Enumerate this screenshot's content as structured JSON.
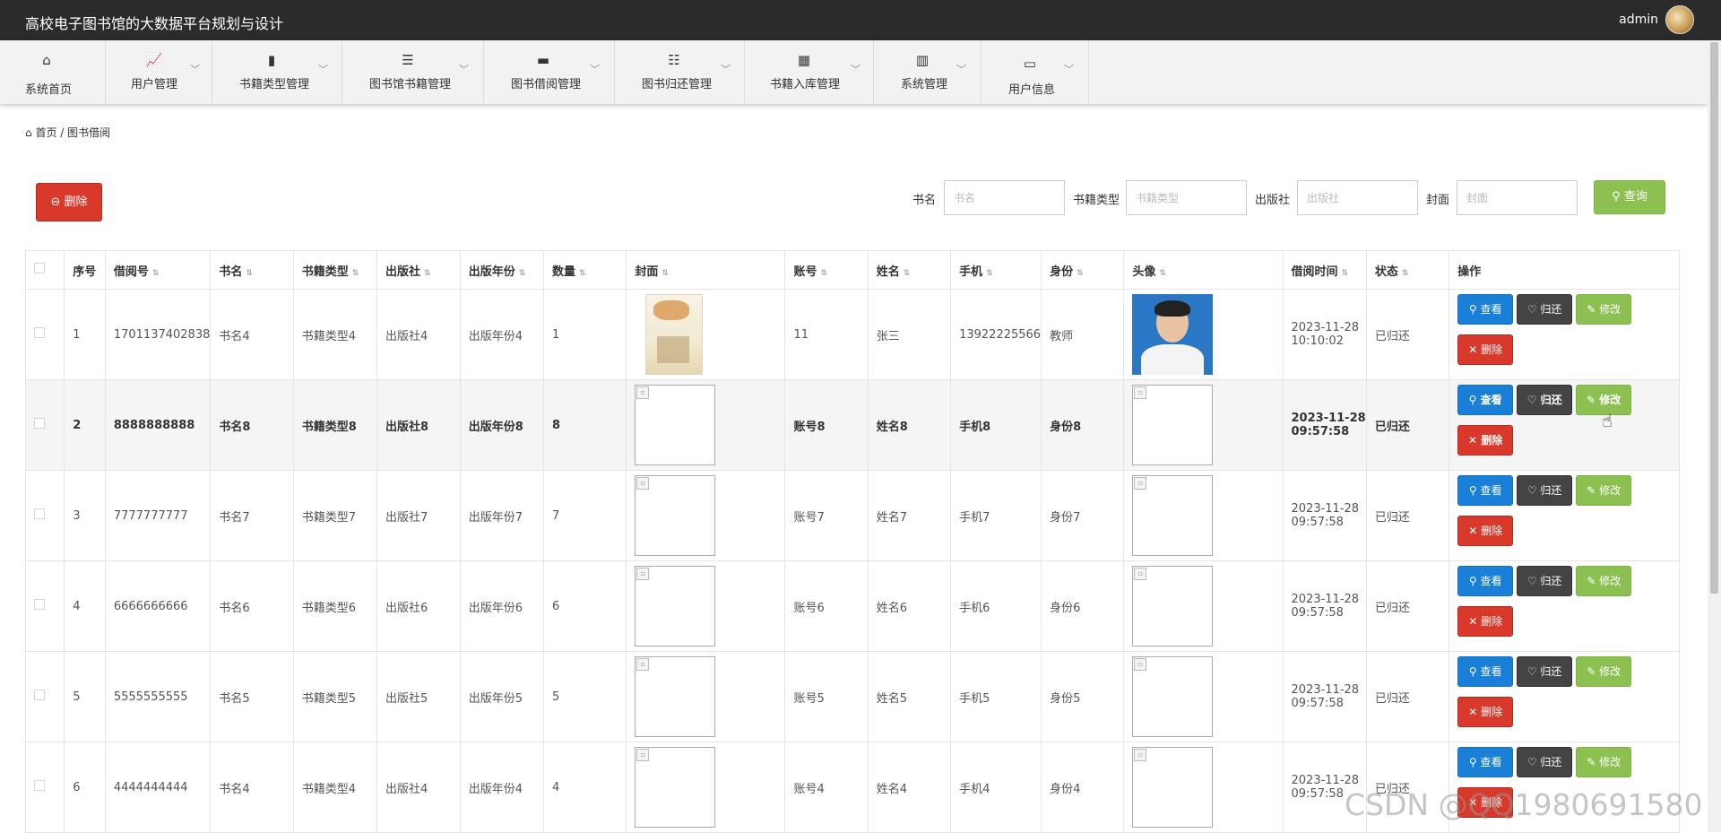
{
  "app": {
    "title": "高校电子图书馆的大数据平台规划与设计",
    "user": "admin"
  },
  "nav": [
    {
      "label": "系统首页",
      "icon": "home-icon"
    },
    {
      "label": "用户管理",
      "icon": "chart-line-icon"
    },
    {
      "label": "书籍类型管理",
      "icon": "ticket-icon"
    },
    {
      "label": "图书馆书籍管理",
      "icon": "list-icon"
    },
    {
      "label": "图书借阅管理",
      "icon": "comment-icon"
    },
    {
      "label": "图书归还管理",
      "icon": "sliders-icon"
    },
    {
      "label": "书籍入库管理",
      "icon": "grid-icon"
    },
    {
      "label": "系统管理",
      "icon": "bar-chart-icon"
    },
    {
      "label": "用户信息",
      "icon": "wallet-icon"
    }
  ],
  "breadcrumb": {
    "home": "首页",
    "sep": "/",
    "current": "图书借阅"
  },
  "toolbar": {
    "delete_label": "删除",
    "query_label": "查询"
  },
  "filters": [
    {
      "label": "书名",
      "placeholder": "书名"
    },
    {
      "label": "书籍类型",
      "placeholder": "书籍类型"
    },
    {
      "label": "出版社",
      "placeholder": "出版社"
    },
    {
      "label": "封面",
      "placeholder": "封面"
    }
  ],
  "table": {
    "headers": [
      "序号",
      "借阅号",
      "书名",
      "书籍类型",
      "出版社",
      "出版年份",
      "数量",
      "封面",
      "账号",
      "姓名",
      "手机",
      "身份",
      "头像",
      "借阅时间",
      "状态",
      "操作"
    ],
    "ops": {
      "view": "查看",
      "return": "归还",
      "edit": "修改",
      "delete": "删除"
    },
    "rows": [
      {
        "no": "1",
        "borrow_no": "1701137402838",
        "book": "书名4",
        "type": "书籍类型4",
        "publisher": "出版社4",
        "year": "出版年份4",
        "qty": "1",
        "account": "11",
        "name": "张三",
        "phone": "13922225566",
        "role": "教师",
        "time_date": "2023-11-28",
        "time_clock": "10:10:02",
        "status": "已归还"
      },
      {
        "no": "2",
        "borrow_no": "8888888888",
        "book": "书名8",
        "type": "书籍类型8",
        "publisher": "出版社8",
        "year": "出版年份8",
        "qty": "8",
        "account": "账号8",
        "name": "姓名8",
        "phone": "手机8",
        "role": "身份8",
        "time_date": "2023-11-28",
        "time_clock": "09:57:58",
        "status": "已归还"
      },
      {
        "no": "3",
        "borrow_no": "7777777777",
        "book": "书名7",
        "type": "书籍类型7",
        "publisher": "出版社7",
        "year": "出版年份7",
        "qty": "7",
        "account": "账号7",
        "name": "姓名7",
        "phone": "手机7",
        "role": "身份7",
        "time_date": "2023-11-28",
        "time_clock": "09:57:58",
        "status": "已归还"
      },
      {
        "no": "4",
        "borrow_no": "6666666666",
        "book": "书名6",
        "type": "书籍类型6",
        "publisher": "出版社6",
        "year": "出版年份6",
        "qty": "6",
        "account": "账号6",
        "name": "姓名6",
        "phone": "手机6",
        "role": "身份6",
        "time_date": "2023-11-28",
        "time_clock": "09:57:58",
        "status": "已归还"
      },
      {
        "no": "5",
        "borrow_no": "5555555555",
        "book": "书名5",
        "type": "书籍类型5",
        "publisher": "出版社5",
        "year": "出版年份5",
        "qty": "5",
        "account": "账号5",
        "name": "姓名5",
        "phone": "手机5",
        "role": "身份5",
        "time_date": "2023-11-28",
        "time_clock": "09:57:58",
        "status": "已归还"
      },
      {
        "no": "6",
        "borrow_no": "4444444444",
        "book": "书名4",
        "type": "书籍类型4",
        "publisher": "出版社4",
        "year": "出版年份4",
        "qty": "4",
        "account": "账号4",
        "name": "姓名4",
        "phone": "手机4",
        "role": "身份4",
        "time_date": "2023-11-28",
        "time_clock": "09:57:58",
        "status": "已归还"
      }
    ]
  },
  "watermark": "CSDN @QQ1980691580"
}
